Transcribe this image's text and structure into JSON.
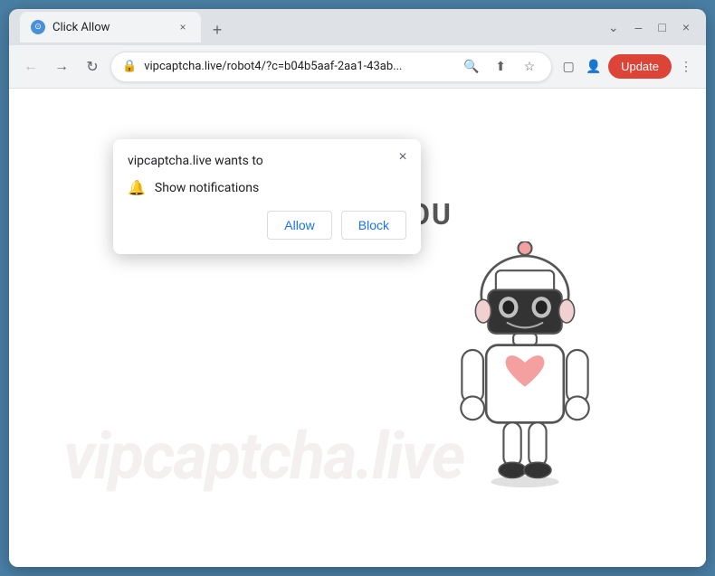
{
  "browser": {
    "title": "Click Allow",
    "tab": {
      "favicon": "⊙",
      "title": "Click Allow",
      "close": "×"
    },
    "new_tab": "+",
    "window_controls": {
      "minimize": "–",
      "maximize": "□",
      "close": "×"
    },
    "nav": {
      "back": "←",
      "forward": "→",
      "refresh": "↻",
      "url": "vipcaptcha.live/robot4/?c=b04b5aaf-2aa1-43ab...",
      "lock": "🔒",
      "search_icon": "🔍",
      "share_icon": "⬆",
      "bookmark_icon": "☆",
      "split_icon": "▢",
      "profile_icon": "👤",
      "update_btn": "Update",
      "menu_icon": "⋮"
    }
  },
  "popup": {
    "title": "vipcaptcha.live wants to",
    "close": "×",
    "permission": {
      "icon": "🔔",
      "text": "Show notifications"
    },
    "buttons": {
      "allow": "Allow",
      "block": "Block"
    }
  },
  "page": {
    "speech_text": "YOU",
    "watermark": "vipcaptcha.live"
  }
}
